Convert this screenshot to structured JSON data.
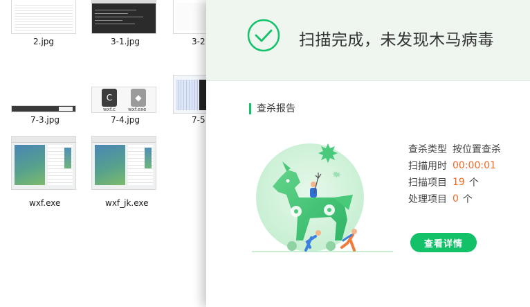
{
  "files": [
    {
      "name": "2.jpg"
    },
    {
      "name": "3-1.jpg"
    },
    {
      "name": "3-2"
    },
    {
      "name": "7-3.jpg"
    },
    {
      "name": "7-4.jpg"
    },
    {
      "name": "7-5"
    },
    {
      "name": "wxf.exe"
    },
    {
      "name": "wxf_jk.exe"
    }
  ],
  "thumb_7_4": {
    "c_glyph": "C",
    "c_label": "wxf.c",
    "exe_label": "wxf.exe"
  },
  "scan": {
    "title": "扫描完成，未发现木马病毒",
    "report_heading": "查杀报告",
    "rows": [
      {
        "key": "查杀类型",
        "value": "按位置查杀",
        "unit": ""
      },
      {
        "key": "扫描用时",
        "value": "00:00:01",
        "unit": ""
      },
      {
        "key": "扫描项目",
        "value": "19",
        "unit": "个"
      },
      {
        "key": "处理项目",
        "value": "0",
        "unit": "个"
      }
    ],
    "details_button": "查看详情"
  },
  "colors": {
    "accent": "#13c26a",
    "highlight": "#f06a25",
    "header_bg": "#eef6ef"
  }
}
